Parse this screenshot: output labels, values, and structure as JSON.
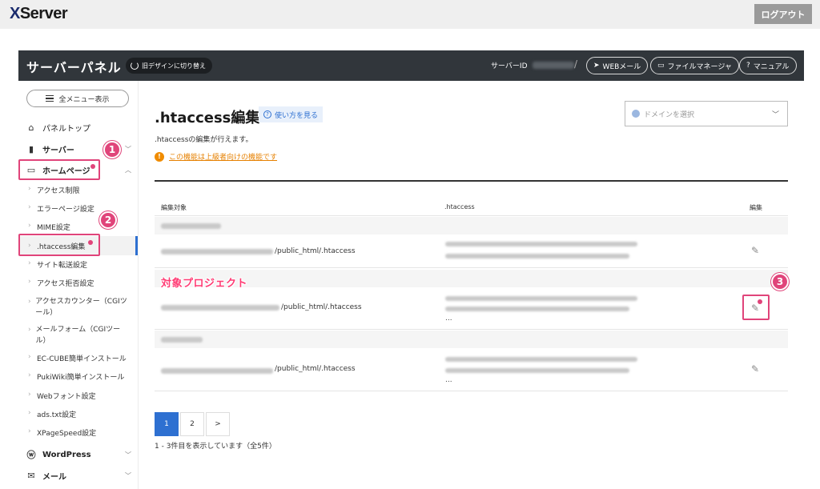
{
  "header": {
    "logo_x": "X",
    "logo_rest": "Server",
    "logout": "ログアウト"
  },
  "panel": {
    "title": "サーバーパネル",
    "old_design": "旧デザインに切り替え",
    "server_id_label": "サーバーID",
    "slash": "/",
    "buttons": [
      {
        "icon": "paper-plane-icon",
        "label": "WEBメール"
      },
      {
        "icon": "folder-icon",
        "label": "ファイルマネージャ"
      },
      {
        "icon": "help-circle-icon",
        "label": "マニュアル"
      }
    ]
  },
  "sidebar": {
    "all_menu": "全メニュー表示",
    "items": [
      {
        "label": "パネルトップ",
        "icon": "home-icon"
      },
      {
        "label": "サーバー",
        "icon": "server-icon"
      },
      {
        "label": "ホームページ",
        "icon": "browser-icon"
      }
    ],
    "subitems": [
      "アクセス制限",
      "エラーページ設定",
      "MIME設定",
      ".htaccess編集",
      "サイト転送設定",
      "アクセス拒否設定",
      "アクセスカウンター（CGIツール）",
      "メールフォーム（CGIツール）",
      "EC-CUBE簡単インストール",
      "PukiWiki簡単インストール",
      "Webフォント設定",
      "ads.txt設定",
      "XPageSpeed設定"
    ],
    "bottom_items": [
      {
        "label": "WordPress",
        "icon": "wordpress-icon"
      },
      {
        "label": "メール",
        "icon": "mail-icon"
      }
    ]
  },
  "annotations": {
    "badge1": "1",
    "badge2": "2",
    "badge3": "3",
    "project_label": "対象プロジェクト"
  },
  "main": {
    "title": ".htaccess編集",
    "howto": "使い方を見る",
    "domain_placeholder": "ドメインを選択",
    "description": ".htaccessの編集が行えます。",
    "warning": "この機能は上級者向けの機能です",
    "columns": [
      "編集対象",
      ".htaccess",
      "編集"
    ],
    "rows": [
      {
        "path": "/public_html/.htaccess",
        "ellipsis": ""
      },
      {
        "path": "/public_html/.htaccess",
        "ellipsis": "..."
      },
      {
        "path": "/public_html/.htaccess",
        "ellipsis": "..."
      }
    ],
    "pagination": [
      "1",
      "2",
      ">"
    ],
    "count_text": "1 - 3件目を表示しています（全5件）"
  }
}
